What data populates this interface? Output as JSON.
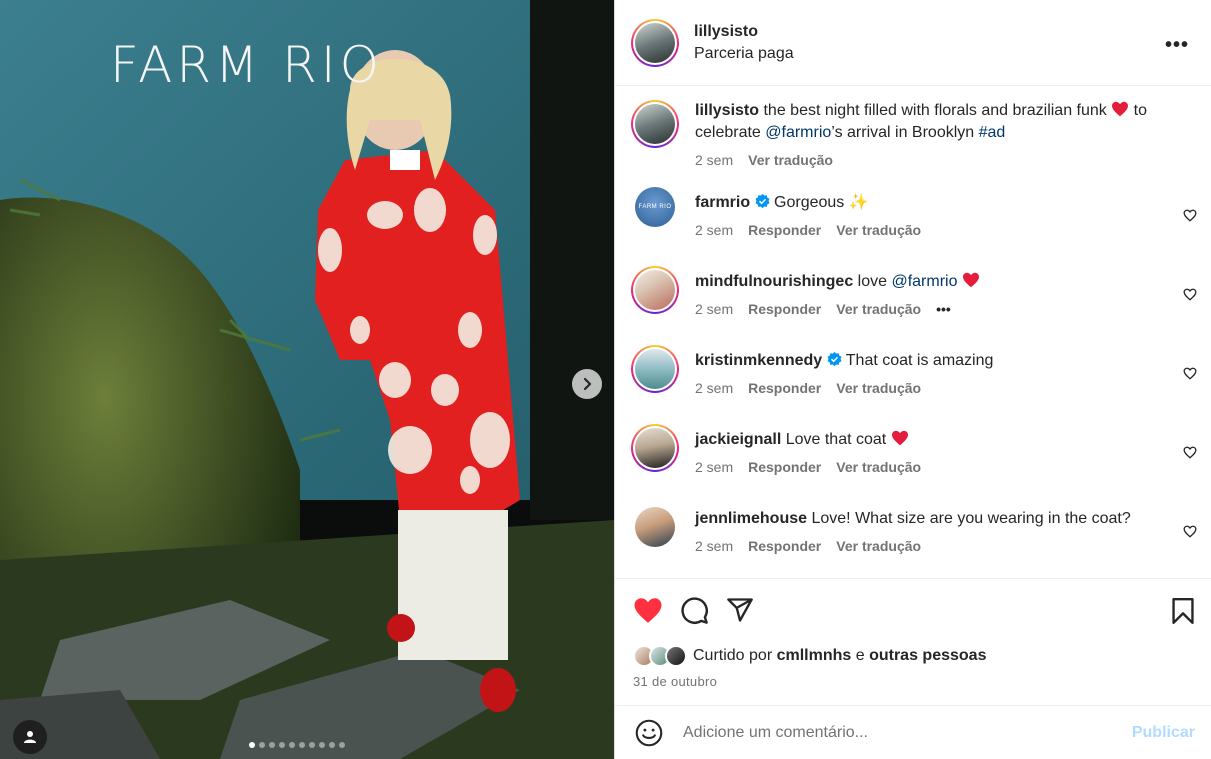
{
  "photo": {
    "brand_text": "FARM RIO",
    "carousel": {
      "total": 10,
      "active_index": 0
    }
  },
  "header": {
    "username": "lillysisto",
    "subtitle": "Parceria paga",
    "more_icon": "more-horizontal-icon"
  },
  "caption": {
    "username": "lillysisto",
    "text_part1": " the best night filled with florals and brazilian funk ",
    "text_part2": " to celebrate ",
    "mention": "@farmrio",
    "text_part3": "’s arrival in Brooklyn ",
    "hashtag": "#ad",
    "time": "2 sem",
    "translate": "Ver tradução"
  },
  "comments": [
    {
      "username": "farmrio",
      "verified": true,
      "text": "Gorgeous",
      "emoji": "✨",
      "time": "2 sem",
      "reply": "Responder",
      "translate": "Ver tradução"
    },
    {
      "username": "mindfulnourishingec",
      "verified": false,
      "text": "love ",
      "mention": "@farmrio",
      "time": "2 sem",
      "reply": "Responder",
      "translate": "Ver tradução",
      "more": "•••"
    },
    {
      "username": "kristinmkennedy",
      "verified": true,
      "text": "That coat is amazing",
      "time": "2 sem",
      "reply": "Responder",
      "translate": "Ver tradução"
    },
    {
      "username": "jackieignall",
      "verified": false,
      "text": "Love that coat",
      "time": "2 sem",
      "reply": "Responder",
      "translate": "Ver tradução"
    },
    {
      "username": "jennlimehouse",
      "verified": false,
      "text": "Love! What size are you wearing in the coat?",
      "time": "2 sem",
      "reply": "Responder",
      "translate": "Ver tradução"
    }
  ],
  "actions": {
    "liked": true,
    "likes_prefix": "Curtido por ",
    "likes_user": "cmllmnhs",
    "likes_mid": " e ",
    "likes_others": "outras pessoas",
    "date": "31 de outubro"
  },
  "add_comment": {
    "placeholder": "Adicione um comentário...",
    "publish": "Publicar"
  },
  "colors": {
    "like_red": "#ff3040",
    "link_blue": "#00376b",
    "verified_blue": "#0095f6",
    "publish_disabled": "#b3dbff",
    "muted": "#737373"
  }
}
